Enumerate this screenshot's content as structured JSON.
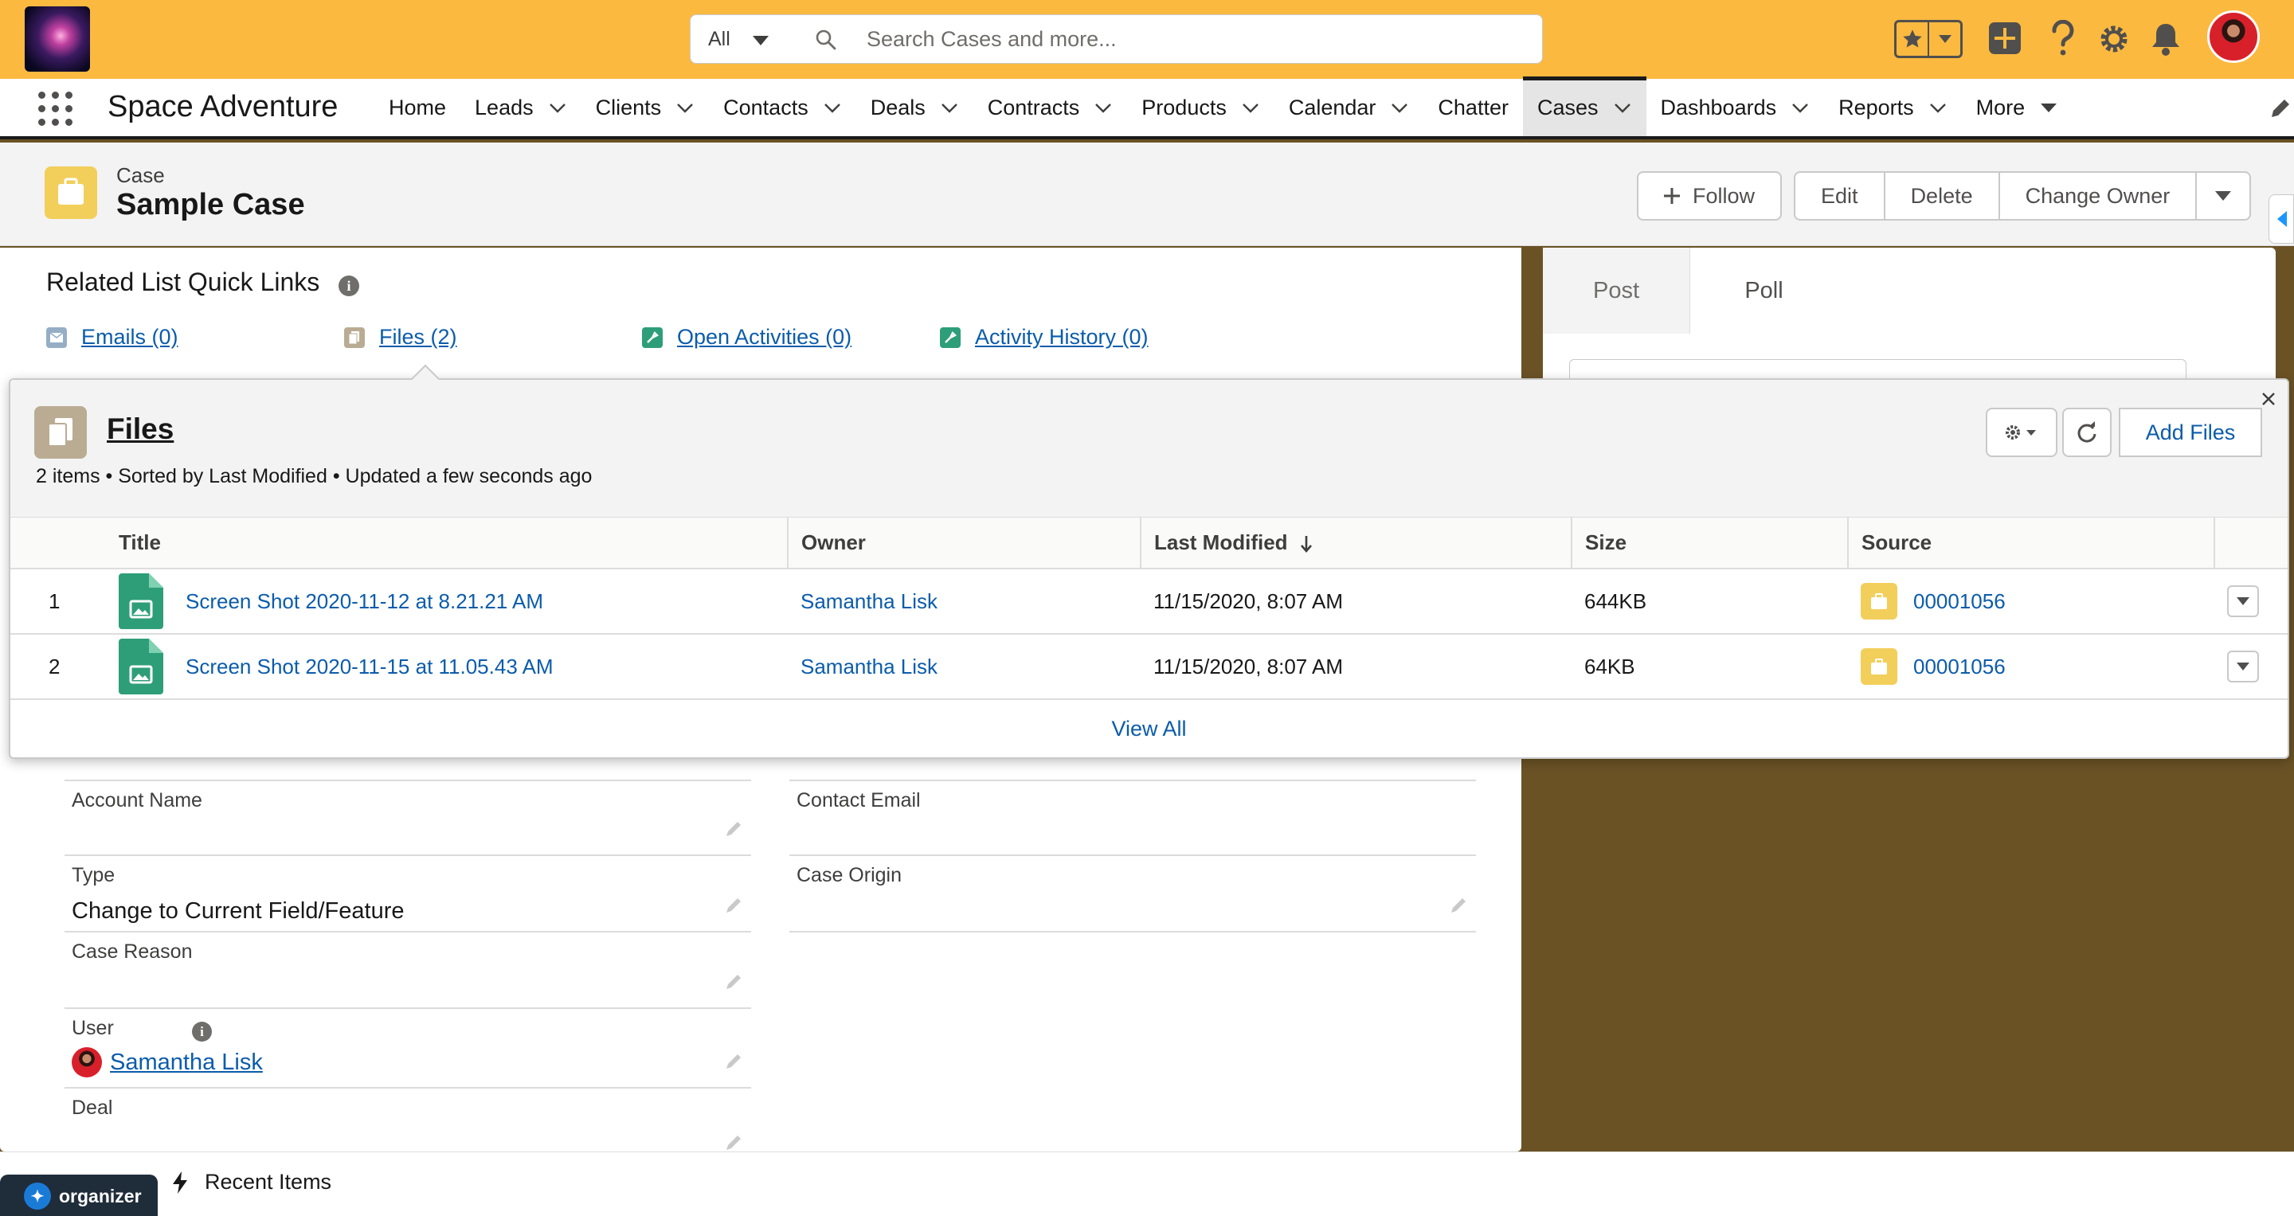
{
  "global": {
    "scope_label": "All",
    "search_placeholder": "Search Cases and more..."
  },
  "nav": {
    "app_name": "Space Adventure",
    "items": [
      {
        "label": "Home",
        "has_menu": false
      },
      {
        "label": "Leads",
        "has_menu": true
      },
      {
        "label": "Clients",
        "has_menu": true
      },
      {
        "label": "Contacts",
        "has_menu": true
      },
      {
        "label": "Deals",
        "has_menu": true
      },
      {
        "label": "Contracts",
        "has_menu": true
      },
      {
        "label": "Products",
        "has_menu": true
      },
      {
        "label": "Calendar",
        "has_menu": true
      },
      {
        "label": "Chatter",
        "has_menu": false
      },
      {
        "label": "Cases",
        "has_menu": true,
        "active": true
      },
      {
        "label": "Dashboards",
        "has_menu": true
      },
      {
        "label": "Reports",
        "has_menu": true
      },
      {
        "label": "More",
        "has_menu": true
      }
    ]
  },
  "record": {
    "object_label": "Case",
    "title": "Sample Case",
    "actions": {
      "follow": "Follow",
      "edit": "Edit",
      "delete": "Delete",
      "change_owner": "Change Owner"
    }
  },
  "quick_links": {
    "title": "Related List Quick Links",
    "links": [
      {
        "label": "Emails (0)",
        "icon": "email-icon"
      },
      {
        "label": "Files (2)",
        "icon": "file-icon"
      },
      {
        "label": "Open Activities (0)",
        "icon": "activity-icon"
      },
      {
        "label": "Activity History (0)",
        "icon": "activity-icon"
      }
    ]
  },
  "feed": {
    "tabs": [
      "Post",
      "Poll"
    ]
  },
  "fields": {
    "account_name": {
      "label": "Account Name",
      "value": ""
    },
    "contact_email": {
      "label": "Contact Email",
      "value": ""
    },
    "type": {
      "label": "Type",
      "value": "Change to Current Field/Feature"
    },
    "case_origin": {
      "label": "Case Origin",
      "value": ""
    },
    "case_reason": {
      "label": "Case Reason",
      "value": ""
    },
    "user": {
      "label": "User",
      "value": "Samantha Lisk"
    },
    "deal": {
      "label": "Deal",
      "value": ""
    }
  },
  "files_panel": {
    "title": "Files",
    "subtitle": "2 items • Sorted by Last Modified • Updated a few seconds ago",
    "add_label": "Add Files",
    "columns": [
      "Title",
      "Owner",
      "Last Modified",
      "Size",
      "Source"
    ],
    "rows": [
      {
        "num": "1",
        "title": "Screen Shot 2020-11-12 at 8.21.21 AM",
        "owner": "Samantha Lisk",
        "modified": "11/15/2020, 8:07 AM",
        "size": "644KB",
        "source": "00001056"
      },
      {
        "num": "2",
        "title": "Screen Shot 2020-11-15 at 11.05.43 AM",
        "owner": "Samantha Lisk",
        "modified": "11/15/2020, 8:07 AM",
        "size": "64KB",
        "source": "00001056"
      }
    ],
    "view_all": "View All"
  },
  "utility": {
    "recent_items": "Recent Items",
    "organizer": "organizer"
  },
  "colors": {
    "header_bg": "#fbb940",
    "page_bg": "#6a5225",
    "link": "#0b5cab",
    "case_icon": "#f2cf5b",
    "file_icon": "#2e9e79"
  }
}
